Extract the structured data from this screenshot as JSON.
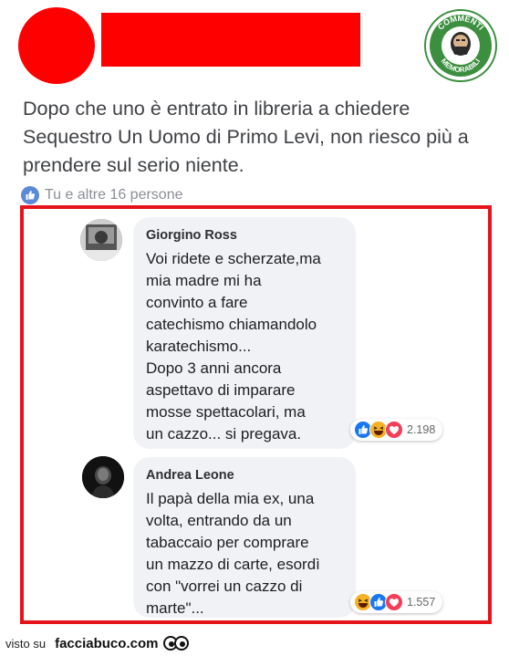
{
  "post": {
    "text_lines": [
      "Dopo che uno è entrato in libreria a chiedere",
      "Sequestro Un Uomo di Primo Levi, non riesco più a",
      "prendere sul serio niente."
    ],
    "likes_text": "Tu e altre 16 persone"
  },
  "logo": {
    "top_text": "COMMENTI",
    "bottom_text": "MEMORABILI"
  },
  "comments": [
    {
      "author": "Giorgino Ross",
      "lines": [
        "Voi ridete e scherzate,ma",
        "mia madre mi ha",
        "convinto a fare",
        "catechismo chiamandolo",
        "karatechismo...",
        "Dopo 3 anni ancora",
        "aspettavo di imparare",
        "mosse spettacolari, ma",
        "un cazzo... si pregava."
      ],
      "reactions": [
        "like-icon",
        "haha-icon",
        "love-icon"
      ],
      "reaction_count": "2.198"
    },
    {
      "author": "Andrea Leone",
      "lines": [
        "Il papà della mia ex, una",
        "volta, entrando da un",
        "tabaccaio per comprare",
        "un mazzo di carte, esordì",
        "con \"vorrei un cazzo di",
        "marte\"..."
      ],
      "reactions": [
        "haha-icon",
        "like-icon",
        "love-icon"
      ],
      "reaction_count": "1.557"
    }
  ],
  "footer": {
    "visto_su": "visto su",
    "brand": "facciabuco.com"
  },
  "colors": {
    "redaction": "#ff0000",
    "frame": "#e5141b",
    "like_blue": "#1877f2",
    "love_red": "#f33e58",
    "haha_yellow": "#f7b125"
  }
}
